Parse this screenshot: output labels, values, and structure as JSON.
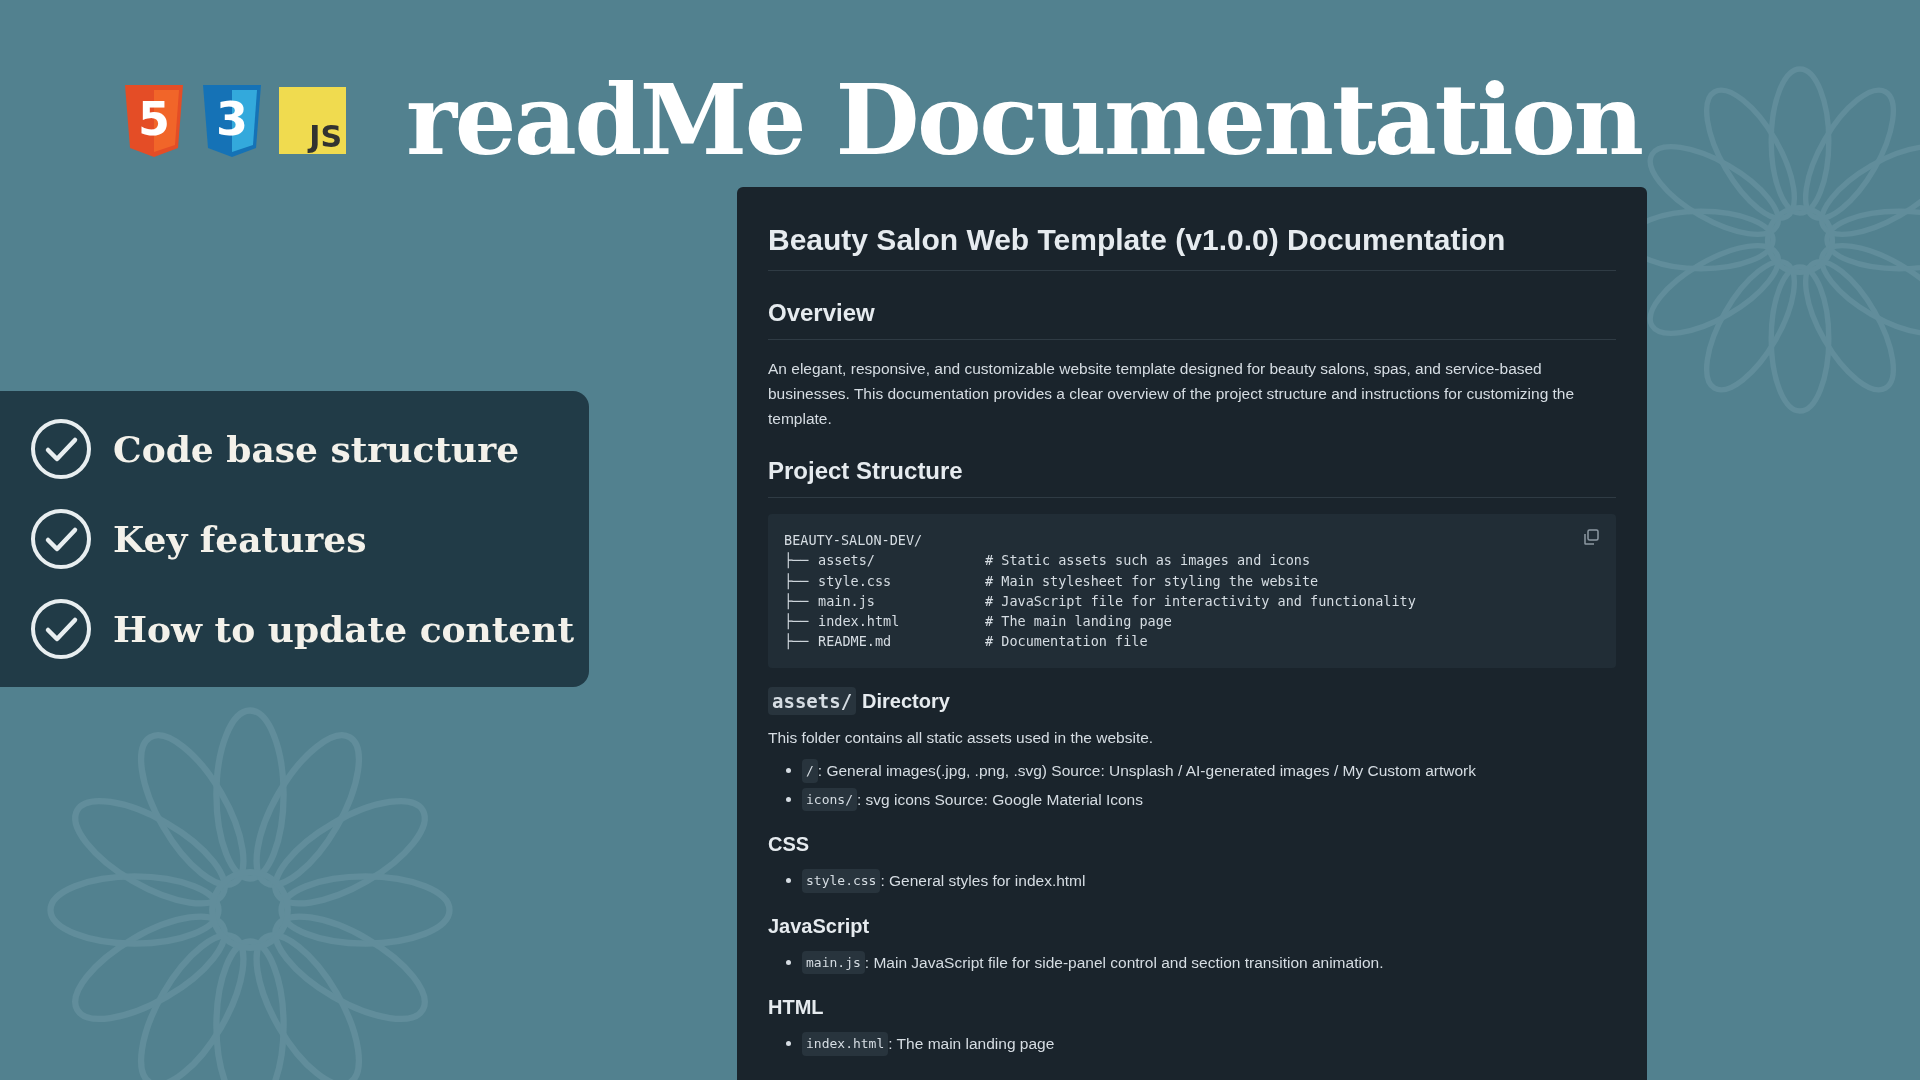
{
  "banner": {
    "logos": [
      {
        "kind": "html",
        "text": "5"
      },
      {
        "kind": "css",
        "text": "3"
      },
      {
        "kind": "js",
        "text": "JS"
      }
    ],
    "title": "readMe Documentation"
  },
  "features": [
    {
      "label": "Code base structure",
      "checked": true
    },
    {
      "label": "Key features",
      "checked": true
    },
    {
      "label": "How to update content",
      "checked": true
    }
  ],
  "document": {
    "title": "Beauty Salon Web Template (v1.0.0) Documentation",
    "overview": {
      "heading": "Overview",
      "text": "An elegant, responsive, and customizable website template designed for beauty salons, spas, and service-based businesses. This documentation provides a clear overview of the project structure and instructions for customizing the template."
    },
    "structure": {
      "heading": "Project Structure",
      "root": "BEAUTY-SALON-DEV/",
      "lines": [
        {
          "branch": "├──",
          "name": "assets/",
          "comment": "# Static assets such as images and icons"
        },
        {
          "branch": "├──",
          "name": "style.css",
          "comment": "# Main stylesheet for styling the website"
        },
        {
          "branch": "├──",
          "name": "main.js",
          "comment": "# JavaScript file for interactivity and functionality"
        },
        {
          "branch": "├──",
          "name": "index.html",
          "comment": "# The main landing page"
        },
        {
          "branch": "├──",
          "name": "README.md",
          "comment": "# Documentation file"
        }
      ]
    },
    "sections": [
      {
        "heading_code": "assets/",
        "heading": "Directory",
        "text": "This folder contains all static assets used in the website.",
        "items": [
          {
            "code": "/",
            "text": ": General images(.jpg, .png, .svg) Source: Unsplash / AI-generated images / My Custom artwork"
          },
          {
            "code": "icons/",
            "text": ": svg icons Source: Google Material Icons"
          }
        ]
      },
      {
        "heading": "CSS",
        "items": [
          {
            "code": "style.css",
            "text": ": General styles for index.html"
          }
        ]
      },
      {
        "heading": "JavaScript",
        "items": [
          {
            "code": "main.js",
            "text": ": Main JavaScript file for side-panel control and section transition animation."
          }
        ]
      },
      {
        "heading": "HTML",
        "items": [
          {
            "code": "index.html",
            "text": ": The main landing page"
          }
        ]
      }
    ]
  }
}
